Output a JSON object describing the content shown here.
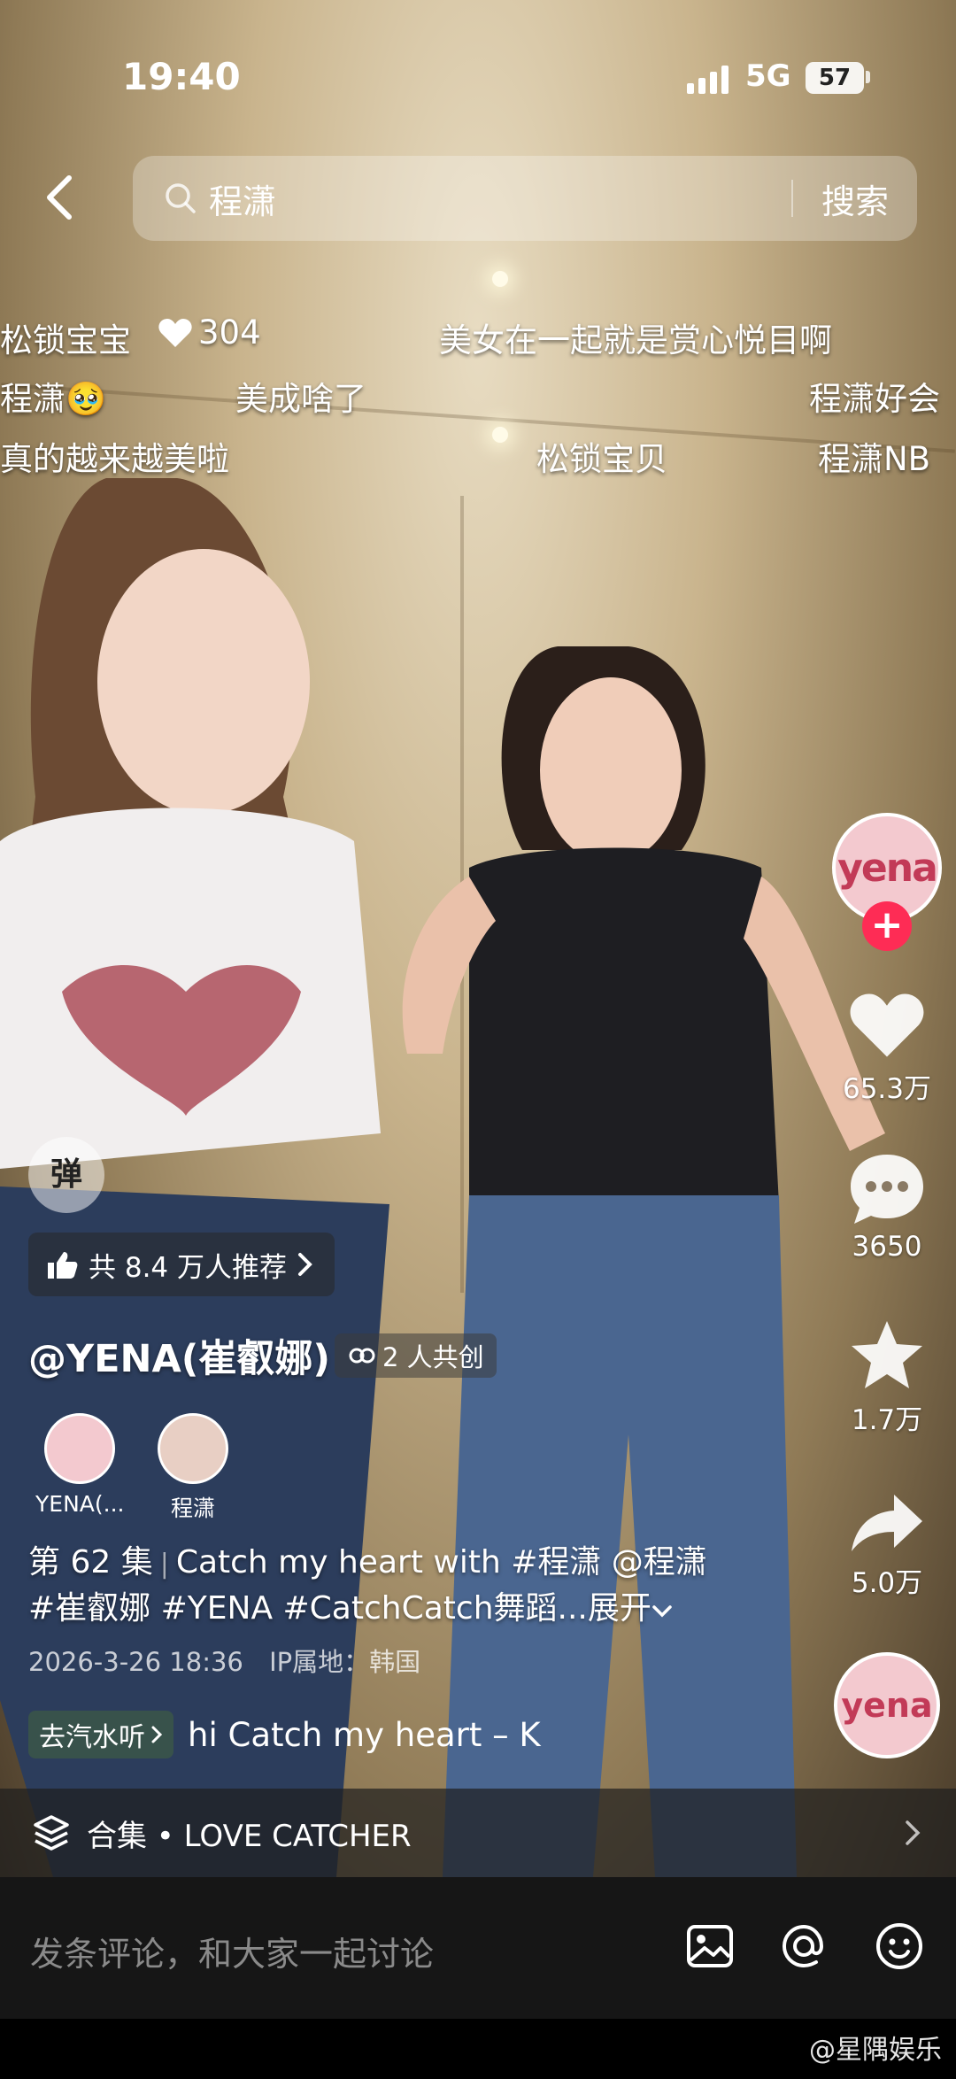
{
  "status_bar": {
    "time": "19:40",
    "network": "5G",
    "battery": "57"
  },
  "search": {
    "query": "程潇",
    "button": "搜索"
  },
  "danmaku": [
    {
      "text": "松锁宝宝"
    },
    {
      "text": "304"
    },
    {
      "text": "美女在一起就是赏心悦目啊"
    },
    {
      "text": "程潇🥹"
    },
    {
      "text": "美成啥了"
    },
    {
      "text": "程潇好会"
    },
    {
      "text": "真的越来越美啦"
    },
    {
      "text": "松锁宝贝"
    },
    {
      "text": "程潇NB"
    }
  ],
  "actions": {
    "likes": "65.3万",
    "comments": "3650",
    "favorites": "1.7万",
    "shares": "5.0万"
  },
  "danmu_toggle": "弹",
  "recommend": "共 8.4 万人推荐",
  "author": {
    "name": "@YENA(崔叡娜)",
    "coop": "2 人共创",
    "coauthors": [
      {
        "name": "YENA(..."
      },
      {
        "name": "程潇"
      }
    ]
  },
  "description": {
    "episode": "第 62 集",
    "line1": "Catch my heart with #程潇 @程潇",
    "line2": "#崔叡娜 #YENA #CatchCatch舞蹈...",
    "expand": "展开"
  },
  "meta": {
    "datetime": "2026-3-26 18:36",
    "ip": "IP属地：韩国"
  },
  "music": {
    "chip": "去汽水听",
    "title": "hi   Catch my heart – K"
  },
  "collection": {
    "label": "合集 • LOVE CATCHER"
  },
  "comment": {
    "placeholder": "发条评论，和大家一起讨论"
  },
  "watermark": "@星隅娱乐",
  "colors": {
    "accent": "#fe2c55",
    "bar": "#161616"
  }
}
